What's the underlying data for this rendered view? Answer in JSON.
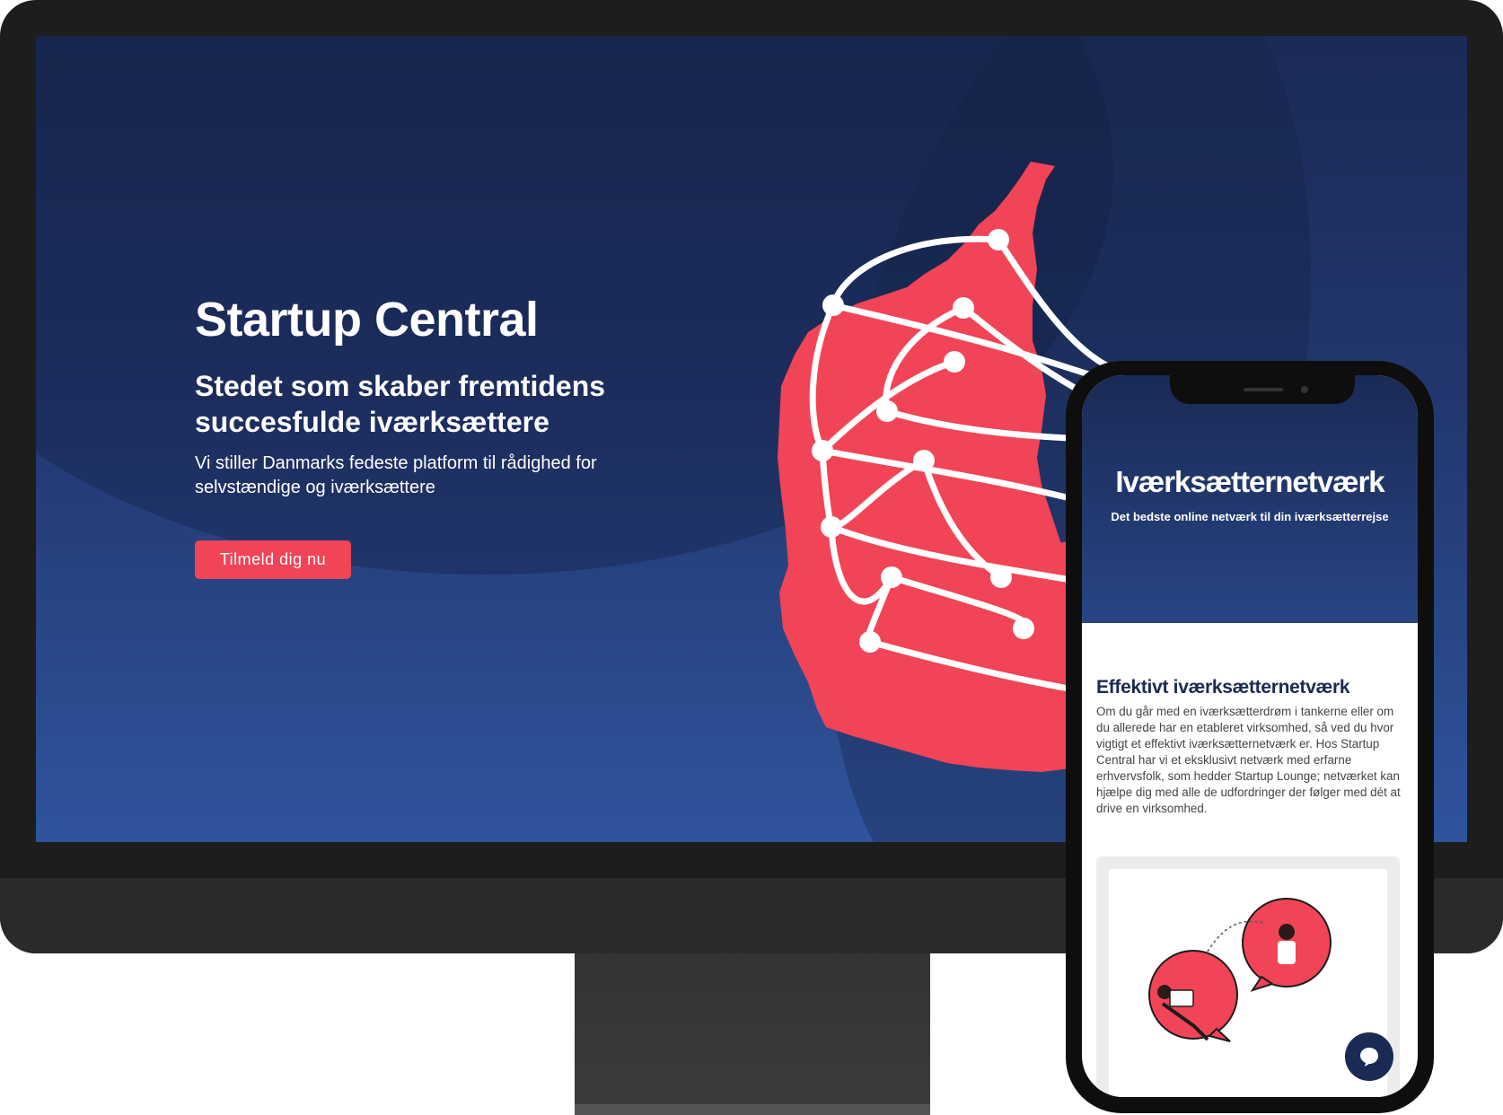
{
  "desktop": {
    "title": "Startup Central",
    "subtitle": "Stedet som skaber fremtidens succesfulde iværksættere",
    "description": "Vi stiller Danmarks fedeste platform til rådighed for selvstændige og iværksættere",
    "cta_label": "Tilmeld dig nu"
  },
  "mobile": {
    "title": "Iværksætternetværk",
    "subtitle": "Det bedste online netværk til din iværksætterrejse",
    "section_heading": "Effektivt iværksætternetværk",
    "section_body": "Om du går med en iværksætterdrøm i tankerne eller om du allerede har en etableret virksomhed, så ved du hvor vigtigt et effektivt iværksætternetværk er. Hos Startup Central har vi et eksklusivt netværk med erfarne erhvervsfolk, som hedder Startup Lounge; netværket kan hjælpe dig med alle de udfordringer der følger med dét at drive en virksomhed."
  },
  "colors": {
    "accent": "#f14456",
    "navy": "#1b2a55",
    "blue": "#2f549d"
  },
  "icons": {
    "chat": "chat-bubble-icon",
    "map": "denmark-network-map"
  }
}
